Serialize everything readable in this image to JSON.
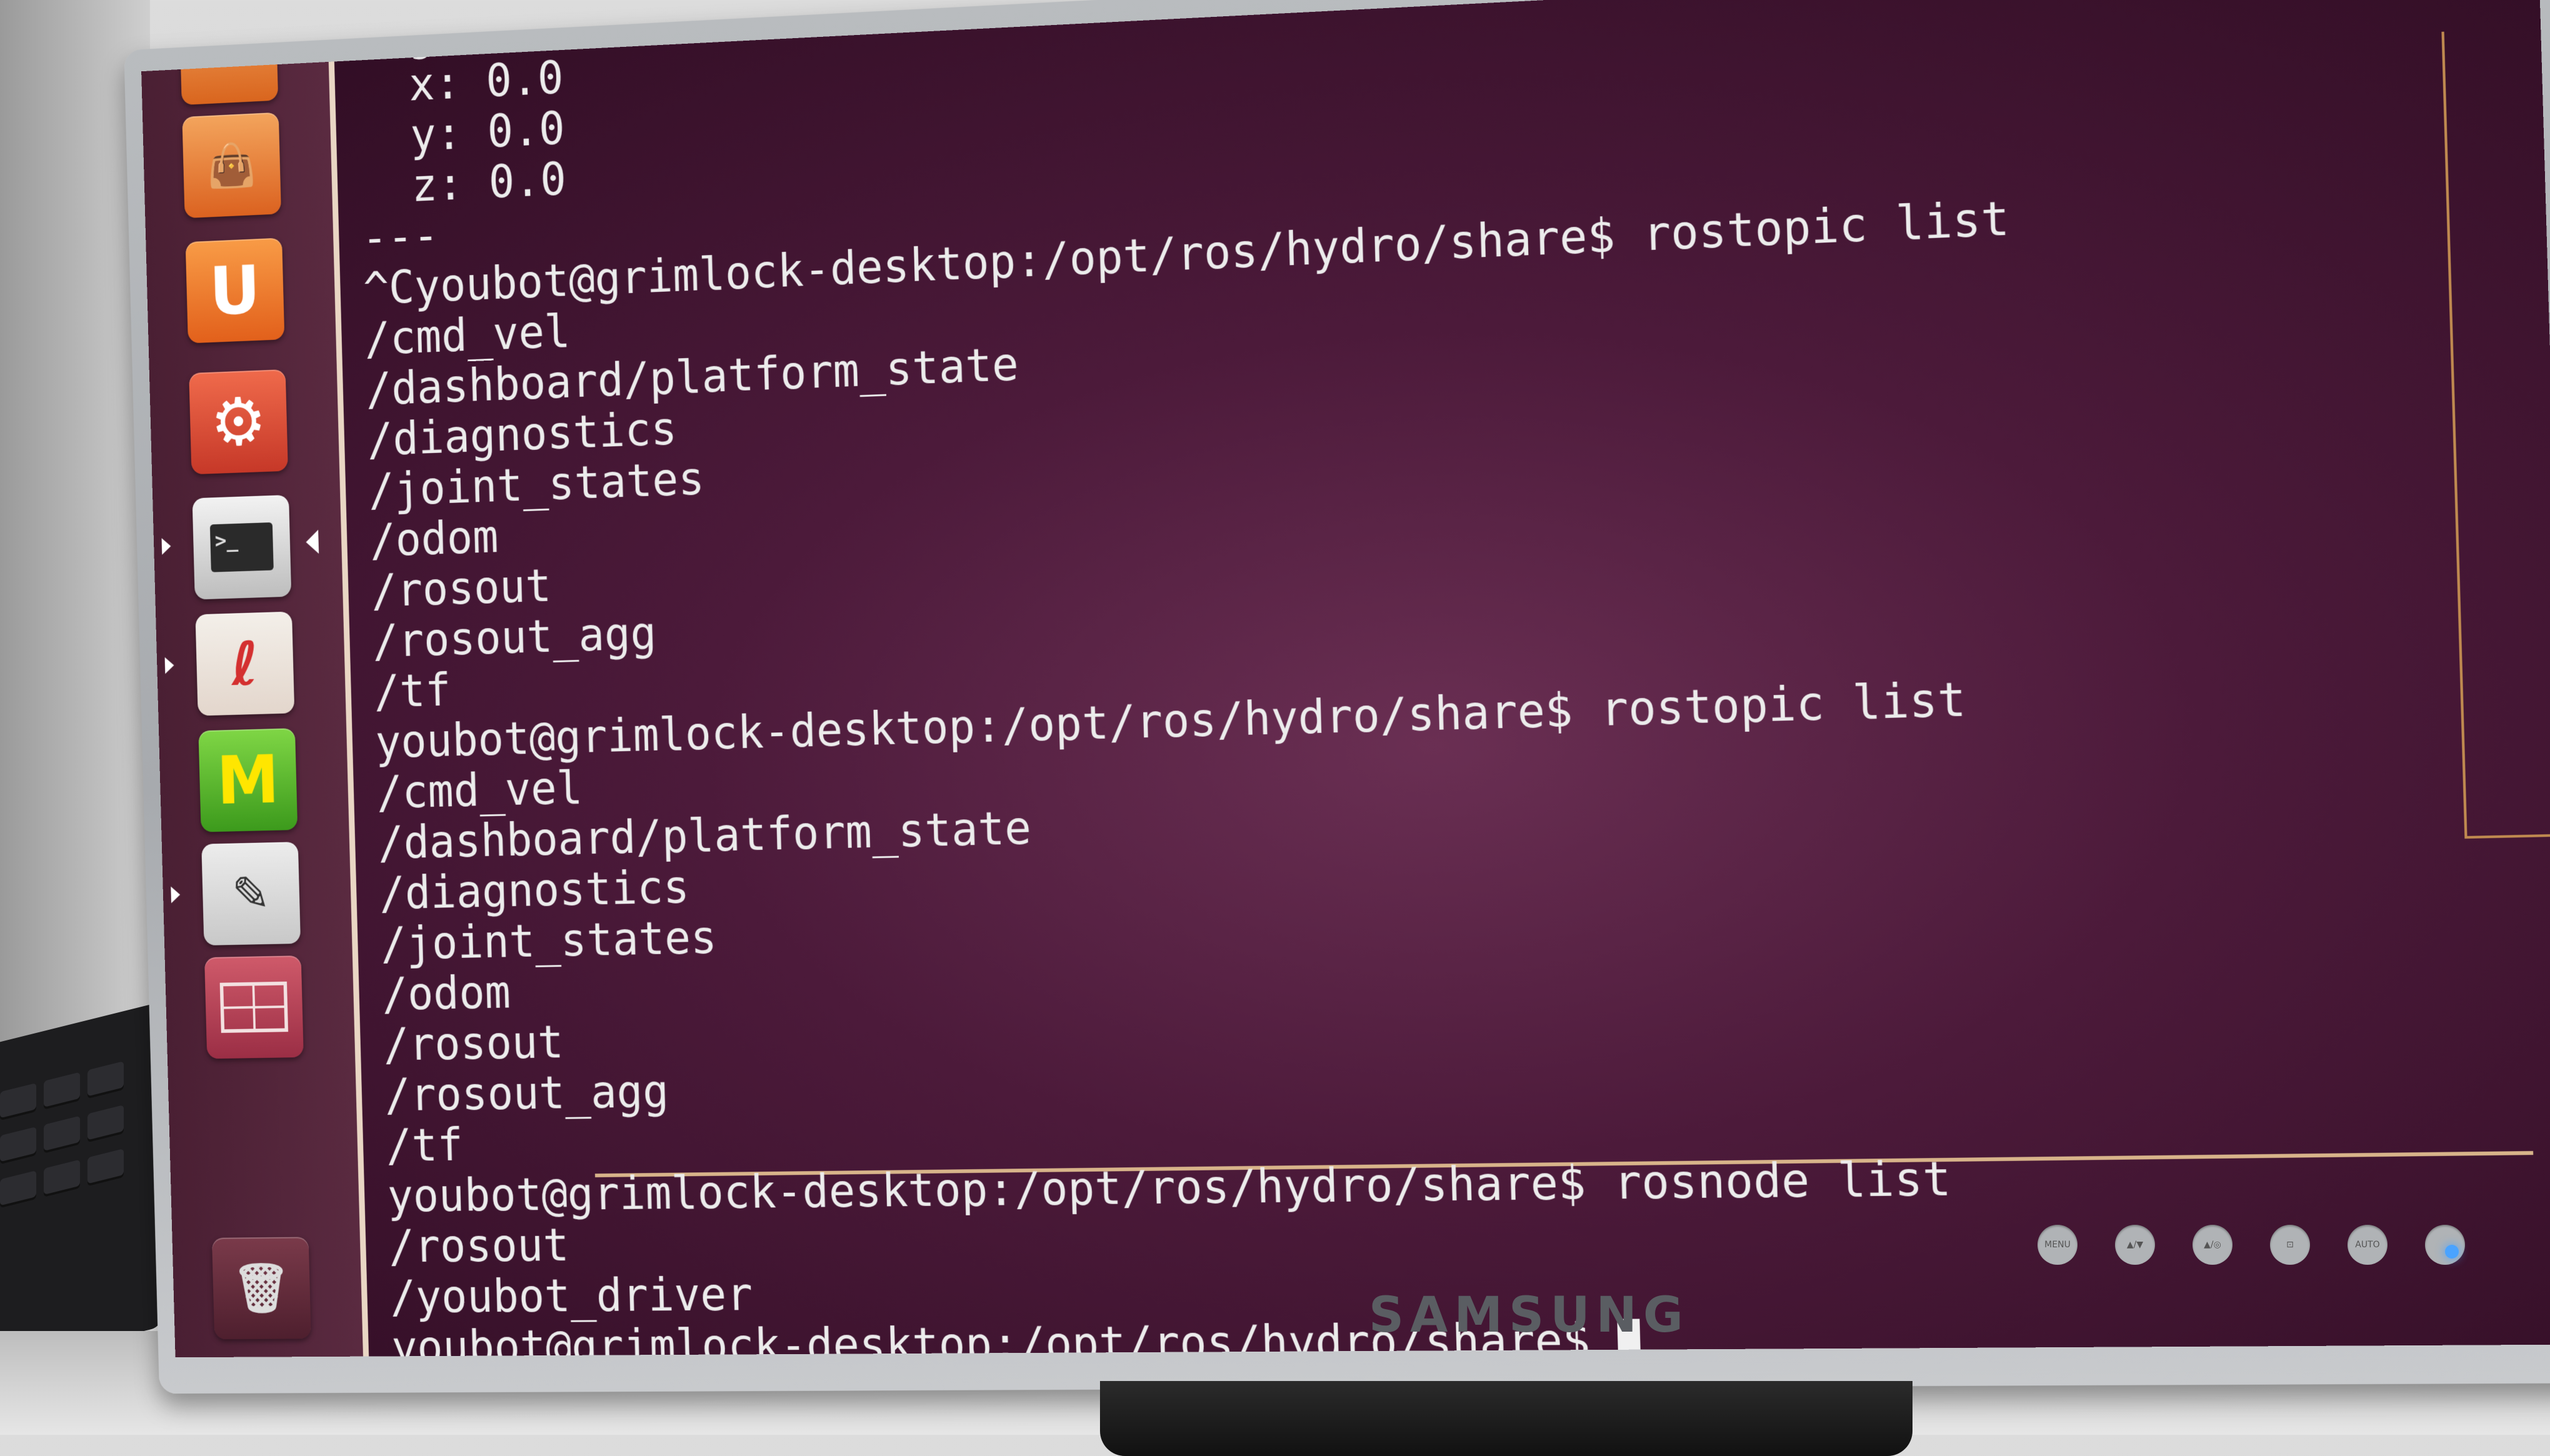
{
  "terminal": {
    "lines": [
      "angular:",
      "  x: 0.0",
      "  y: 0.0",
      "  z: 0.0",
      "---",
      "^Cyoubot@grimlock-desktop:/opt/ros/hydro/share$ rostopic list",
      "/cmd_vel",
      "/dashboard/platform_state",
      "/diagnostics",
      "/joint_states",
      "/odom",
      "/rosout",
      "/rosout_agg",
      "/tf",
      "youbot@grimlock-desktop:/opt/ros/hydro/share$ rostopic list",
      "/cmd_vel",
      "/dashboard/platform_state",
      "/diagnostics",
      "/joint_states",
      "/odom",
      "/rosout",
      "/rosout_agg",
      "/tf",
      "youbot@grimlock-desktop:/opt/ros/hydro/share$ rosnode list",
      "/rosout",
      "/youbot_driver",
      "youbot@grimlock-desktop:/opt/ros/hydro/share$ "
    ]
  },
  "launcher": {
    "items": [
      {
        "name": "files",
        "icon": "folder-icon"
      },
      {
        "name": "ubuntu-software-center",
        "icon": "shopping-bag-icon"
      },
      {
        "name": "ubuntu-one",
        "icon": "ubuntu-one-icon",
        "glyph": "U"
      },
      {
        "name": "system-settings",
        "icon": "settings-icon",
        "glyph": "⚙"
      },
      {
        "name": "terminal",
        "icon": "terminal-icon",
        "glyph": ">_"
      },
      {
        "name": "app",
        "icon": "robot-logo-icon",
        "glyph": "ℓ"
      },
      {
        "name": "app-m",
        "icon": "m-logo-icon",
        "glyph": "M"
      },
      {
        "name": "text-editor",
        "icon": "pencil-icon",
        "glyph": "✎"
      },
      {
        "name": "workspace-switcher",
        "icon": "workspaces-icon"
      },
      {
        "name": "trash",
        "icon": "trash-icon",
        "glyph": "🗑"
      }
    ]
  },
  "monitor": {
    "brand": "SAMSUNG",
    "buttons": [
      "MENU",
      "▲/▼",
      "▲/◎",
      "⊡",
      "AUTO"
    ]
  },
  "colors": {
    "terminal_bg": "#3f1232",
    "terminal_text": "#ececec",
    "launcher_bg": "#4a1f33",
    "ubuntu_orange": "#e2601b"
  }
}
